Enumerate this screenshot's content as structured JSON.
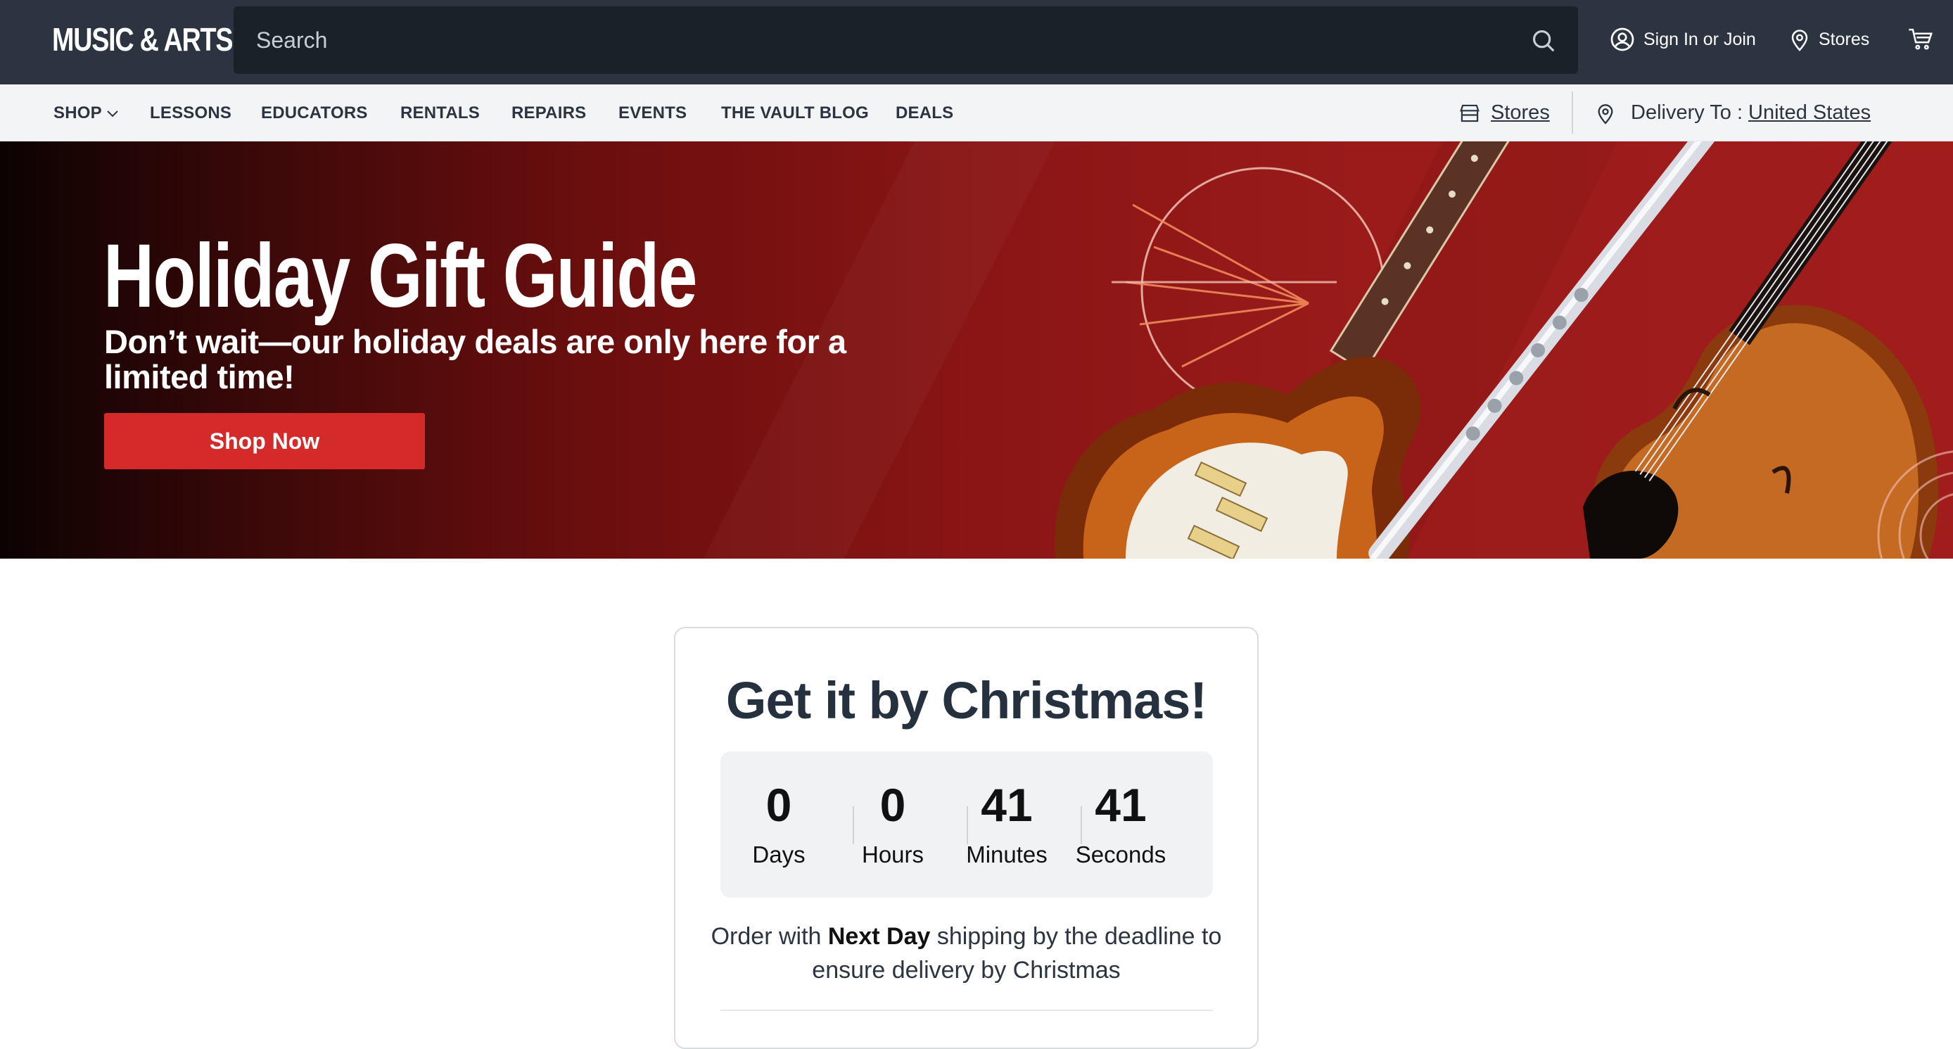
{
  "header": {
    "logo": "MUSIC & ARTS",
    "search_placeholder": "Search",
    "signin_label": "Sign In or Join",
    "stores_label": "Stores"
  },
  "nav": {
    "items": [
      "SHOP",
      "LESSONS",
      "EDUCATORS",
      "RENTALS",
      "REPAIRS",
      "EVENTS",
      "THE VAULT BLOG",
      "DEALS"
    ],
    "stores_label": "Stores",
    "delivery_prefix": "Delivery To :",
    "delivery_country": "United States"
  },
  "hero": {
    "title": "Holiday Gift Guide",
    "subtitle": "Don’t wait—our holiday deals are only here for a limited time!",
    "cta": "Shop Now"
  },
  "countdown": {
    "title": "Get it by Christmas!",
    "units": [
      {
        "value": "0",
        "label": "Days"
      },
      {
        "value": "0",
        "label": "Hours"
      },
      {
        "value": "41",
        "label": "Minutes"
      },
      {
        "value": "41",
        "label": "Seconds"
      }
    ],
    "note_pre": "Order with ",
    "note_bold": "Next Day",
    "note_post": " shipping by the deadline to ensure delivery by Christmas"
  },
  "colors": {
    "header_bg": "#2b3440",
    "search_bg": "#1b2129",
    "nav_bg": "#f3f4f6",
    "hero_red": "#9a1b1a",
    "cta_red": "#d42a2a"
  },
  "icons": [
    "search-icon",
    "user-icon",
    "map-pin-icon",
    "cart-icon",
    "chevron-down-icon",
    "store-icon"
  ]
}
